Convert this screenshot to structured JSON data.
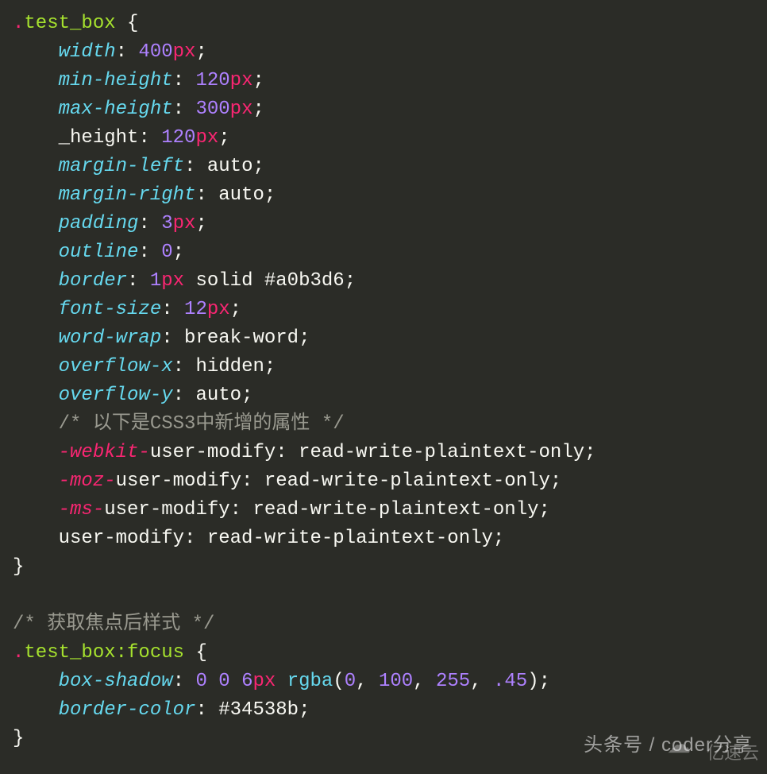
{
  "rule1": {
    "selector_dot": ".",
    "selector_name": "test_box",
    "open": " {",
    "decls": [
      {
        "prop": "width",
        "style": "italic",
        "value": "400",
        "unit": "px",
        "tail": ";"
      },
      {
        "prop": "min-height",
        "style": "italic",
        "value": "120",
        "unit": "px",
        "tail": ";"
      },
      {
        "prop": "max-height",
        "style": "italic",
        "value": "300",
        "unit": "px",
        "tail": ";"
      },
      {
        "prop": "_height",
        "style": "plain",
        "value": "120",
        "unit": "px",
        "tail": ";"
      },
      {
        "prop": "margin-left",
        "style": "italic",
        "text": "auto",
        "tail": ";"
      },
      {
        "prop": "margin-right",
        "style": "italic",
        "text": "auto",
        "tail": ";"
      },
      {
        "prop": "padding",
        "style": "italic",
        "value": "3",
        "unit": "px",
        "tail": ";"
      },
      {
        "prop": "outline",
        "style": "italic",
        "value": "0",
        "tail": ";"
      },
      {
        "prop": "border",
        "style": "italic",
        "value": "1",
        "unit": "px",
        "text2": " solid #a0b3d6",
        "tail": ";"
      },
      {
        "prop": "font-size",
        "style": "italic",
        "value": "12",
        "unit": "px",
        "tail": ";"
      },
      {
        "prop": "word-wrap",
        "style": "italic",
        "text": "break-word",
        "tail": ";"
      },
      {
        "prop": "overflow-x",
        "style": "italic",
        "text": "hidden",
        "tail": ";"
      },
      {
        "prop": "overflow-y",
        "style": "italic",
        "text": "auto",
        "tail": ";"
      }
    ],
    "comment1": "/* 以下是CSS3中新增的属性 */",
    "vendor": [
      {
        "prefix": "-webkit-",
        "rest": "user-modify: read-write-plaintext-only;"
      },
      {
        "prefix": "-moz-",
        "rest": "user-modify: read-write-plaintext-only;"
      },
      {
        "prefix": "-ms-",
        "rest": "user-modify: read-write-plaintext-only;"
      },
      {
        "prefix": "",
        "rest": "user-modify: read-write-plaintext-only;"
      }
    ],
    "close": "}"
  },
  "comment2": "/* 获取焦点后样式 */",
  "rule2": {
    "selector_dot": ".",
    "selector_name": "test_box",
    "pseudo": ":focus",
    "open": " {",
    "decls": [
      {
        "prop": "box-shadow",
        "style": "italic",
        "parts": {
          "n1": "0",
          "n2": "0",
          "n3": "6",
          "unit": "px",
          "func": "rgba",
          "a1": "0",
          "a2": "100",
          "a3": "255",
          "a4": ".45"
        },
        "tail": ";"
      },
      {
        "prop": "border-color",
        "style": "italic",
        "text": "#34538b",
        "tail": ";"
      }
    ],
    "close": "}"
  },
  "watermark_main": "头条号 / coder分享",
  "watermark_logo": "☁",
  "watermark_logo_text": "亿速云"
}
